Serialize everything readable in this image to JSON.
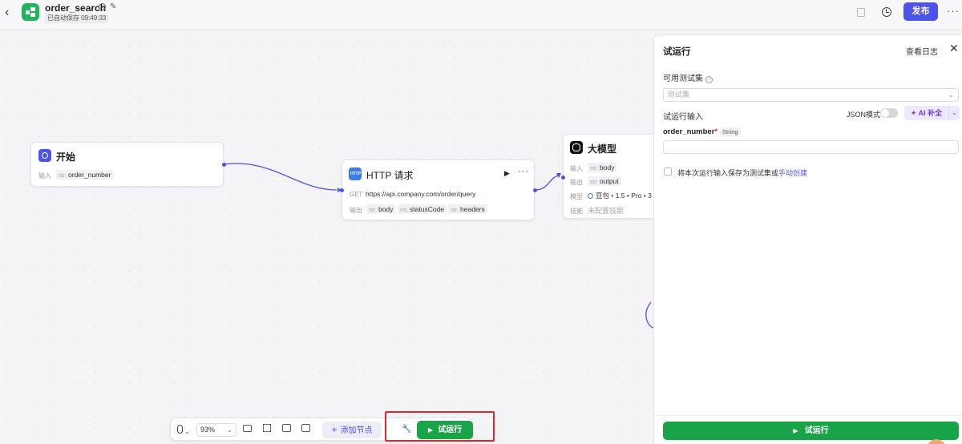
{
  "header": {
    "title": "order_search",
    "autosave": "已自动保存 09:49:33",
    "publish_label": "发布"
  },
  "nodes": {
    "start": {
      "title": "开始",
      "input_label": "输入",
      "input_type": "str.",
      "input_name": "order_number"
    },
    "http": {
      "title": "HTTP 请求",
      "method": "GET",
      "url": "https://api.company.com/order/query",
      "output_label": "输出",
      "outputs": [
        {
          "type": "str.",
          "name": "body"
        },
        {
          "type": "int.",
          "name": "statusCode"
        },
        {
          "type": "str.",
          "name": "headers"
        }
      ]
    },
    "llm": {
      "title": "大模型",
      "input_label": "输入",
      "input_type": "str.",
      "input_name": "body",
      "output_label": "输出",
      "output_type": "str.",
      "output_name": "output",
      "model_label": "模型",
      "model_value": "豆包 • 1.5 • Pro • 3",
      "skill_label": "技能",
      "skill_value": "未配置技能"
    }
  },
  "toolbar": {
    "zoom": "93%",
    "add_node_label": "添加节点",
    "run_label": "试运行"
  },
  "panel": {
    "title": "试运行",
    "view_log": "查看日志",
    "testset_label": "可用测试集",
    "testset_placeholder": "测试集",
    "input_section": "试运行输入",
    "json_mode": "JSON模式",
    "ai_fill": "AI 补全",
    "field_name": "order_number",
    "field_type": "String",
    "save_text": "将本次运行输入保存为测试集或",
    "save_link": "手动创建",
    "run_label": "试运行"
  },
  "colors": {
    "accent": "#4d53e8",
    "run_green": "#1aa44a",
    "highlight_red": "#e02828"
  }
}
